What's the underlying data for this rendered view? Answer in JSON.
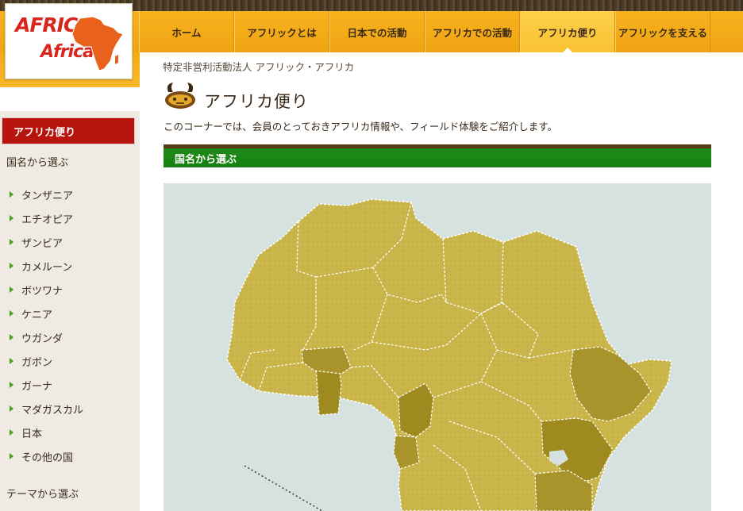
{
  "logo": {
    "line1": "AFRIC",
    "line2": "Africa"
  },
  "nav": {
    "items": [
      {
        "label": "ホーム",
        "width": 120
      },
      {
        "label": "アフリックとは",
        "width": 120
      },
      {
        "label": "日本での活動",
        "width": 120
      },
      {
        "label": "アフリカでの活動",
        "width": 120
      },
      {
        "label": "アフリカ便り",
        "width": 120,
        "active": true
      },
      {
        "label": "アフリックを支える",
        "width": 120
      }
    ]
  },
  "org_name": "特定非営利活動法人 アフリック・アフリカ",
  "page": {
    "title": "アフリカ便り",
    "intro": "このコーナーでは、会員のとっておきアフリカ情報や、フィールド体験をご紹介します。",
    "section_title": "国名から選ぶ"
  },
  "sidebar": {
    "current": "アフリカ便り",
    "heading_country": "国名から選ぶ",
    "countries": [
      "タンザニア",
      "エチオピア",
      "ザンビア",
      "カメルーン",
      "ボツワナ",
      "ケニア",
      "ウガンダ",
      "ガボン",
      "ガーナ",
      "マダガスカル",
      "日本",
      "その他の国"
    ],
    "heading_theme": "テーマから選ぶ"
  },
  "colors": {
    "accent": "#f7b21e",
    "current": "#b8140e",
    "section": "#1f8a18",
    "map_land": "#c9b54a",
    "map_highlight": "#9e8a1f",
    "map_water": "#d5e2e0"
  }
}
